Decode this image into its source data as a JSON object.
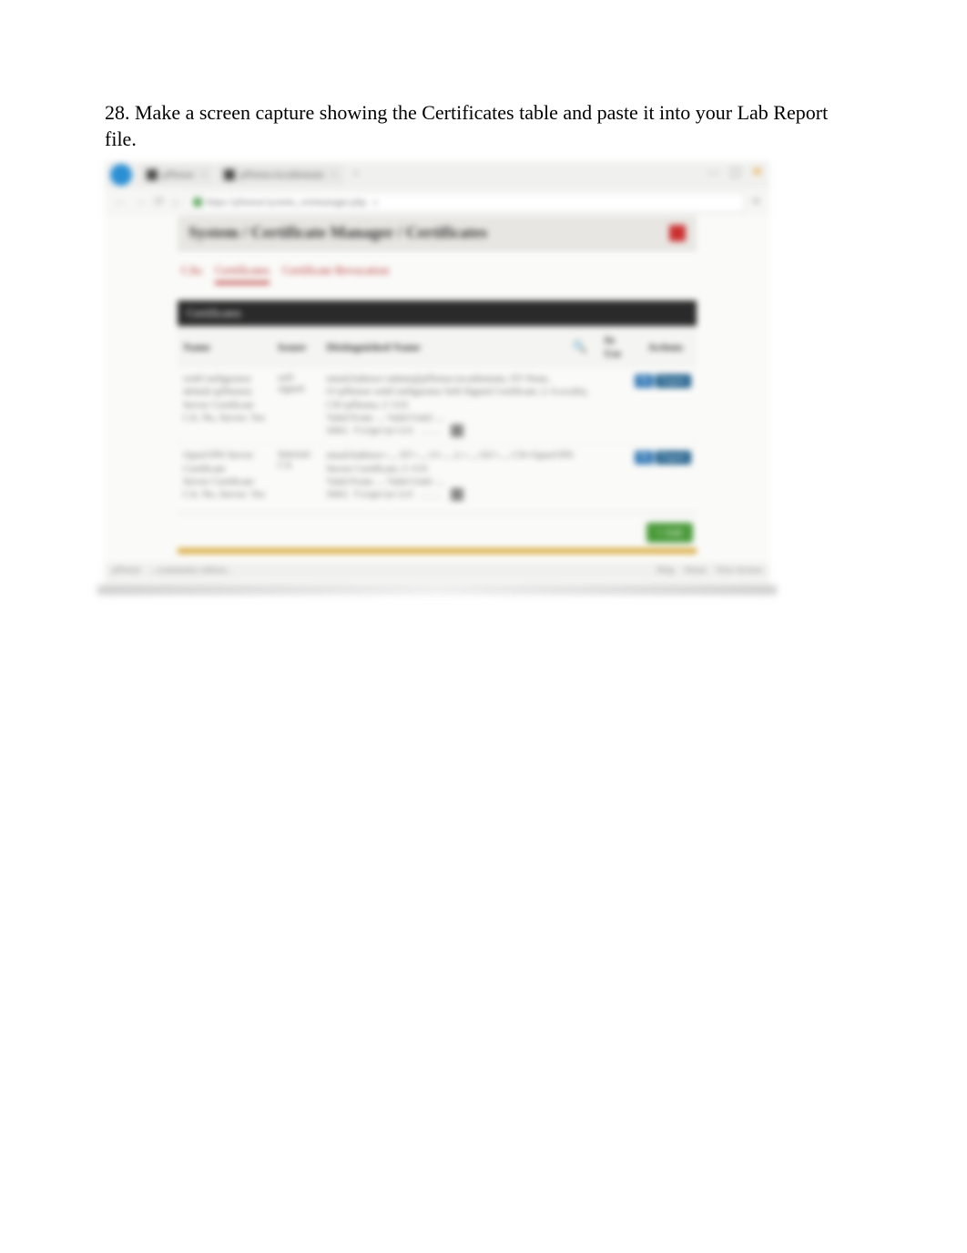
{
  "instruction": "28. Make a screen capture showing the Certificates table and paste it into your Lab Report file.",
  "browser": {
    "tab1_title": "pfSense",
    "tab2_title": "pfSense.localdomain",
    "tab_close": "×",
    "plus": "+",
    "win_min": "—",
    "win_max": "▢",
    "win_close": "✕",
    "nav_back": "←",
    "nav_fwd": "→",
    "nav_reload": "⟳",
    "nav_home": "⌂",
    "url": "https://pfsense/system_certmanager.php",
    "menu": "≡"
  },
  "breadcrumb": {
    "p1": "System",
    "sep": " / ",
    "p2": "Certificate Manager",
    "p3": "Certificates"
  },
  "tabs": {
    "t1": "CAs",
    "t2": "Certificates",
    "t3": "Certificate Revocation"
  },
  "section_header": "Certificates",
  "columns": {
    "name": "Name",
    "issuer": "Issuer",
    "dn": "Distinguished Name",
    "inuse": "In Use",
    "actions": "Actions"
  },
  "rows": [
    {
      "name": "webConfigurator default (pfSense)",
      "name_sub": "Server Certificate",
      "name_ca": "CA: No, Server: Yes",
      "issuer": "self-signed",
      "dn": "emailAddress=admin@pfSense.localdomain, ST=State, O=pfSense webConfigurator Self-Signed Certificate, L=Locality, CN=pfSense, C=US",
      "valid": "Valid From: ... Valid Until: ...",
      "fp": "SHA1 Fingerprint ....",
      "actions_edit": "✎",
      "actions_export": "Export"
    },
    {
      "name": "OpenVPN Server Certificate",
      "name_sub": "Server Certificate",
      "name_ca": "CA: No, Server: Yes",
      "issuer": "Internal-CA",
      "dn": "emailAddress=..., ST=..., O=..., L=..., OU=..., CN=OpenVPN Server Certificate, C=US",
      "valid": "Valid From: ... Valid Until: ...",
      "fp": "SHA1 Fingerprint ....",
      "actions_edit": "✎",
      "actions_export": "Export"
    }
  ],
  "add_button": "+ Add",
  "status": {
    "left1": "pfSense",
    "left2": "...community edition...",
    "r1": "Help",
    "r2": "About",
    "r3": "View license"
  }
}
